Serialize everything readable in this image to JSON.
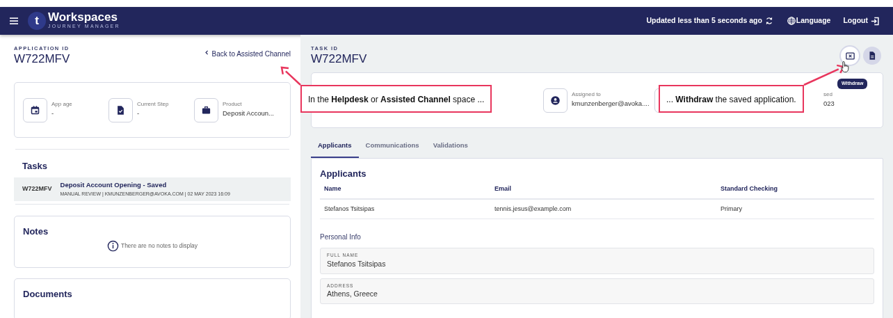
{
  "header": {
    "logo_letter": "t",
    "brand": "Workspaces",
    "subtitle": "JOURNEY MANAGER",
    "status": "Updated less than 5 seconds ago",
    "language": "Language",
    "logout": "Logout"
  },
  "application": {
    "label": "APPLICATION ID",
    "id": "W722MFV",
    "back_link": "Back to Assisted Channel"
  },
  "summary": [
    {
      "kind": "calendar",
      "label": "App age",
      "value": "-"
    },
    {
      "kind": "document",
      "label": "Current Step",
      "value": "-"
    },
    {
      "kind": "briefcase",
      "label": "Product",
      "value": "Deposit Accoun..."
    }
  ],
  "tasks": {
    "title": "Tasks",
    "items": [
      {
        "id": "W722MFV",
        "title": "Deposit Account Opening - Saved",
        "meta": "MANUAL REVIEW | KMUNZENBERGER@AVOKA.COM | 02 MAY 2023 16:09",
        "selected": true
      }
    ]
  },
  "notes": {
    "title": "Notes",
    "empty": "There are no notes to display"
  },
  "documents": {
    "title": "Documents"
  },
  "task": {
    "label": "TASK ID",
    "id": "W722MFV",
    "actions": [
      {
        "kind": "withdraw",
        "tooltip": "Withdraw",
        "hovered": true
      },
      {
        "kind": "document",
        "hovered": false
      }
    ]
  },
  "task_stats": [
    {
      "kind": "blank"
    },
    {
      "kind": "blank"
    },
    {
      "kind": "user",
      "label": "Assigned to",
      "value": "kmunzenberger@avoka...."
    },
    {
      "kind": "blank"
    },
    {
      "kind": "blank",
      "label": "sed",
      "value": "023"
    }
  ],
  "tabs": [
    {
      "label": "Applicants",
      "selected": true
    },
    {
      "label": "Communications",
      "selected": false
    },
    {
      "label": "Validations",
      "selected": false
    }
  ],
  "applicants": {
    "title": "Applicants",
    "columns": [
      "Name",
      "Email",
      "Standard Checking"
    ],
    "rows": [
      [
        "Stefanos Tsitsipas",
        "tennis.jesus@example.com",
        "Primary"
      ]
    ]
  },
  "personal_info": {
    "title": "Personal Info",
    "fields": [
      {
        "label": "FULL NAME",
        "value": "Stefanos Tsitsipas"
      },
      {
        "label": "ADDRESS",
        "value": "Athens, Greece"
      }
    ]
  },
  "callouts": [
    {
      "text": "In the **Helpdesk** or **Assisted Channel** space ..."
    },
    {
      "text": "... **Withdraw** the saved application."
    }
  ]
}
